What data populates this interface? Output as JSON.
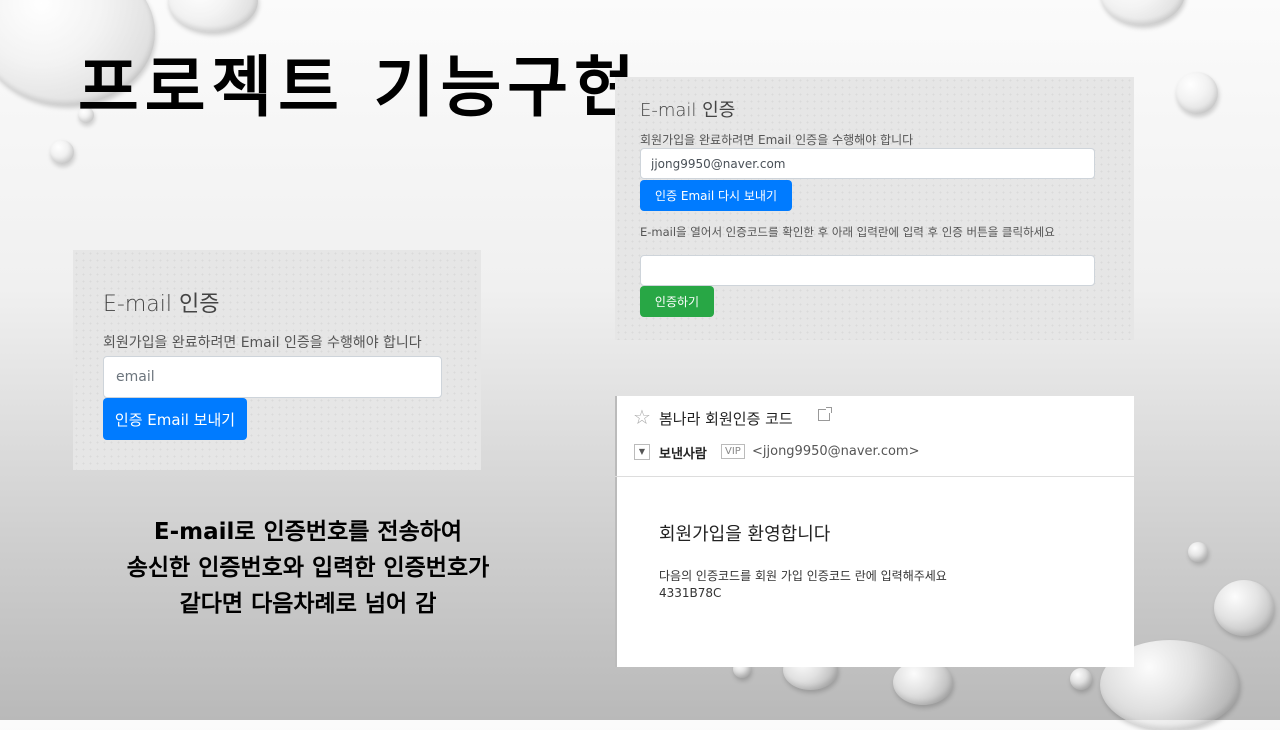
{
  "slide": {
    "title": "프로젝트 기능구현",
    "caption": [
      "E-mail로 인증번호를 전송하여",
      "송신한 인증번호와 입력한 인증번호가",
      "같다면 다음차례로 넘어 감"
    ]
  },
  "panel_left": {
    "title": "E-mail 인증",
    "description": "회원가입을 완료하려면 Email 인증을 수행해야 합니다",
    "email_placeholder": "email",
    "send_button": "인증 Email 보내기"
  },
  "panel_right": {
    "title": "E-mail 인증",
    "description": "회원가입을 완료하려면 Email 인증을 수행해야 합니다",
    "email_value": "jjong9950@naver.com",
    "resend_button": "인증 Email 다시 보내기",
    "instruction": "E-mail을 열어서 인증코드를 확인한 후 아래 입력란에 입력 후 인증 버튼을 클릭하세요",
    "code_value": "",
    "verify_button": "인증하기"
  },
  "email_view": {
    "subject": "봄나라 회원인증 코드",
    "sender_label": "보낸사람",
    "vip_badge": "VIP",
    "sender_address": "<jjong9950@naver.com>",
    "welcome": "회원가입을 환영합니다",
    "body": "다음의 인증코드를 회원 가입 인증코드 란에 입력해주세요",
    "code": "4331B78C"
  },
  "colors": {
    "primary": "#007bff",
    "success": "#28a745",
    "panel_bg": "#e6e6e6"
  }
}
